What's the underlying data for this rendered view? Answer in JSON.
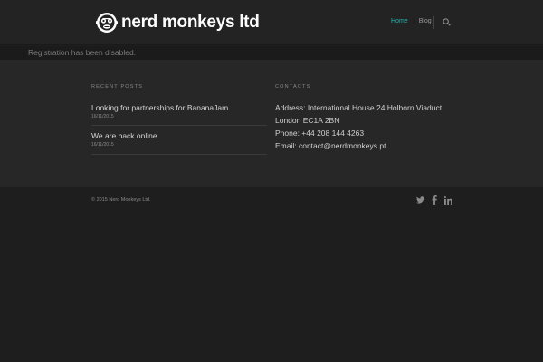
{
  "header": {
    "logo_text": "nerd monkeys ltd",
    "nav": [
      {
        "label": "Home",
        "active": true
      },
      {
        "label": "Blog",
        "active": false
      }
    ]
  },
  "notice": {
    "text": "Registration has been disabled."
  },
  "recent_posts": {
    "title": "RECENT POSTS",
    "items": [
      {
        "title": "Looking for partnerships for BananaJam",
        "date": "16/11/2015"
      },
      {
        "title": "We are back online",
        "date": "16/11/2015"
      }
    ]
  },
  "contacts": {
    "title": "CONTACTS",
    "address": "Address: International House 24 Holborn Viaduct",
    "city": "London EC1A 2BN",
    "phone": "Phone: +44 208 144 4263",
    "email": "Email: contact@nerdmonkeys.pt"
  },
  "footer": {
    "copyright": "© 2015 Nerd Monkeys Ltd.",
    "social": [
      "twitter-icon",
      "facebook-icon",
      "linkedin-icon"
    ]
  },
  "colors": {
    "accent": "#2bb5b0",
    "header_bg": "#232323",
    "widgets_bg": "#272727",
    "footer_bg": "#1e1e1e"
  }
}
